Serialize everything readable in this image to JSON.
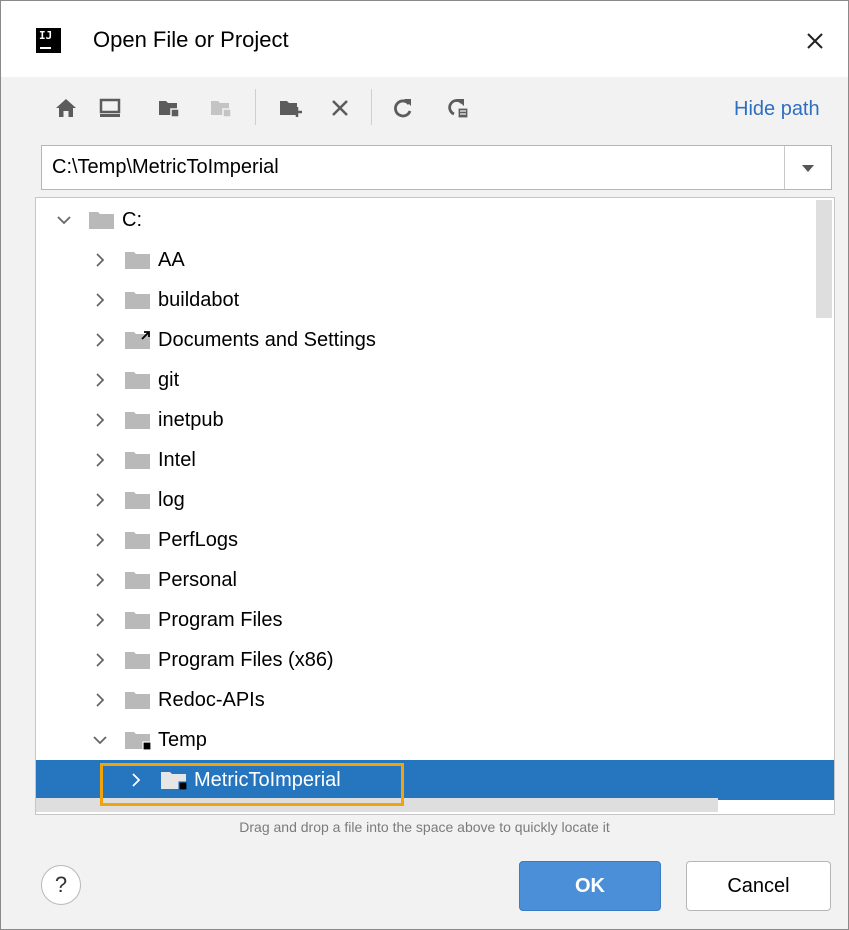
{
  "window": {
    "title": "Open File or Project",
    "app_logo_text": "IJ"
  },
  "toolbar": {
    "buttons": [
      "home-icon",
      "desktop-icon",
      "project-folder-icon",
      "module-folder-icon",
      "new-folder-icon",
      "delete-icon",
      "refresh-icon",
      "show-hidden-icon"
    ],
    "hide_path_label": "Hide path"
  },
  "path": {
    "value": "C:\\Temp\\MetricToImperial"
  },
  "tree": {
    "items": [
      {
        "label": "C:",
        "expanded": true
      },
      {
        "label": "AA"
      },
      {
        "label": "buildabot"
      },
      {
        "label": "Documents and Settings",
        "symlink": true
      },
      {
        "label": "git"
      },
      {
        "label": "inetpub"
      },
      {
        "label": "Intel"
      },
      {
        "label": "log"
      },
      {
        "label": "PerfLogs"
      },
      {
        "label": "Personal"
      },
      {
        "label": "Program Files"
      },
      {
        "label": "Program Files (x86)"
      },
      {
        "label": "Redoc-APIs"
      },
      {
        "label": "Temp",
        "expanded": true,
        "module": true
      },
      {
        "label": "MetricToImperial",
        "selected": true,
        "module": true
      }
    ]
  },
  "hint": "Drag and drop a file into the space above to quickly locate it",
  "buttons": {
    "help": "?",
    "ok": "OK",
    "cancel": "Cancel"
  },
  "colors": {
    "selection": "#2675bf",
    "focus_outline": "#f0a30a",
    "link": "#2f6fc0",
    "ok_button": "#4a8fd8"
  }
}
